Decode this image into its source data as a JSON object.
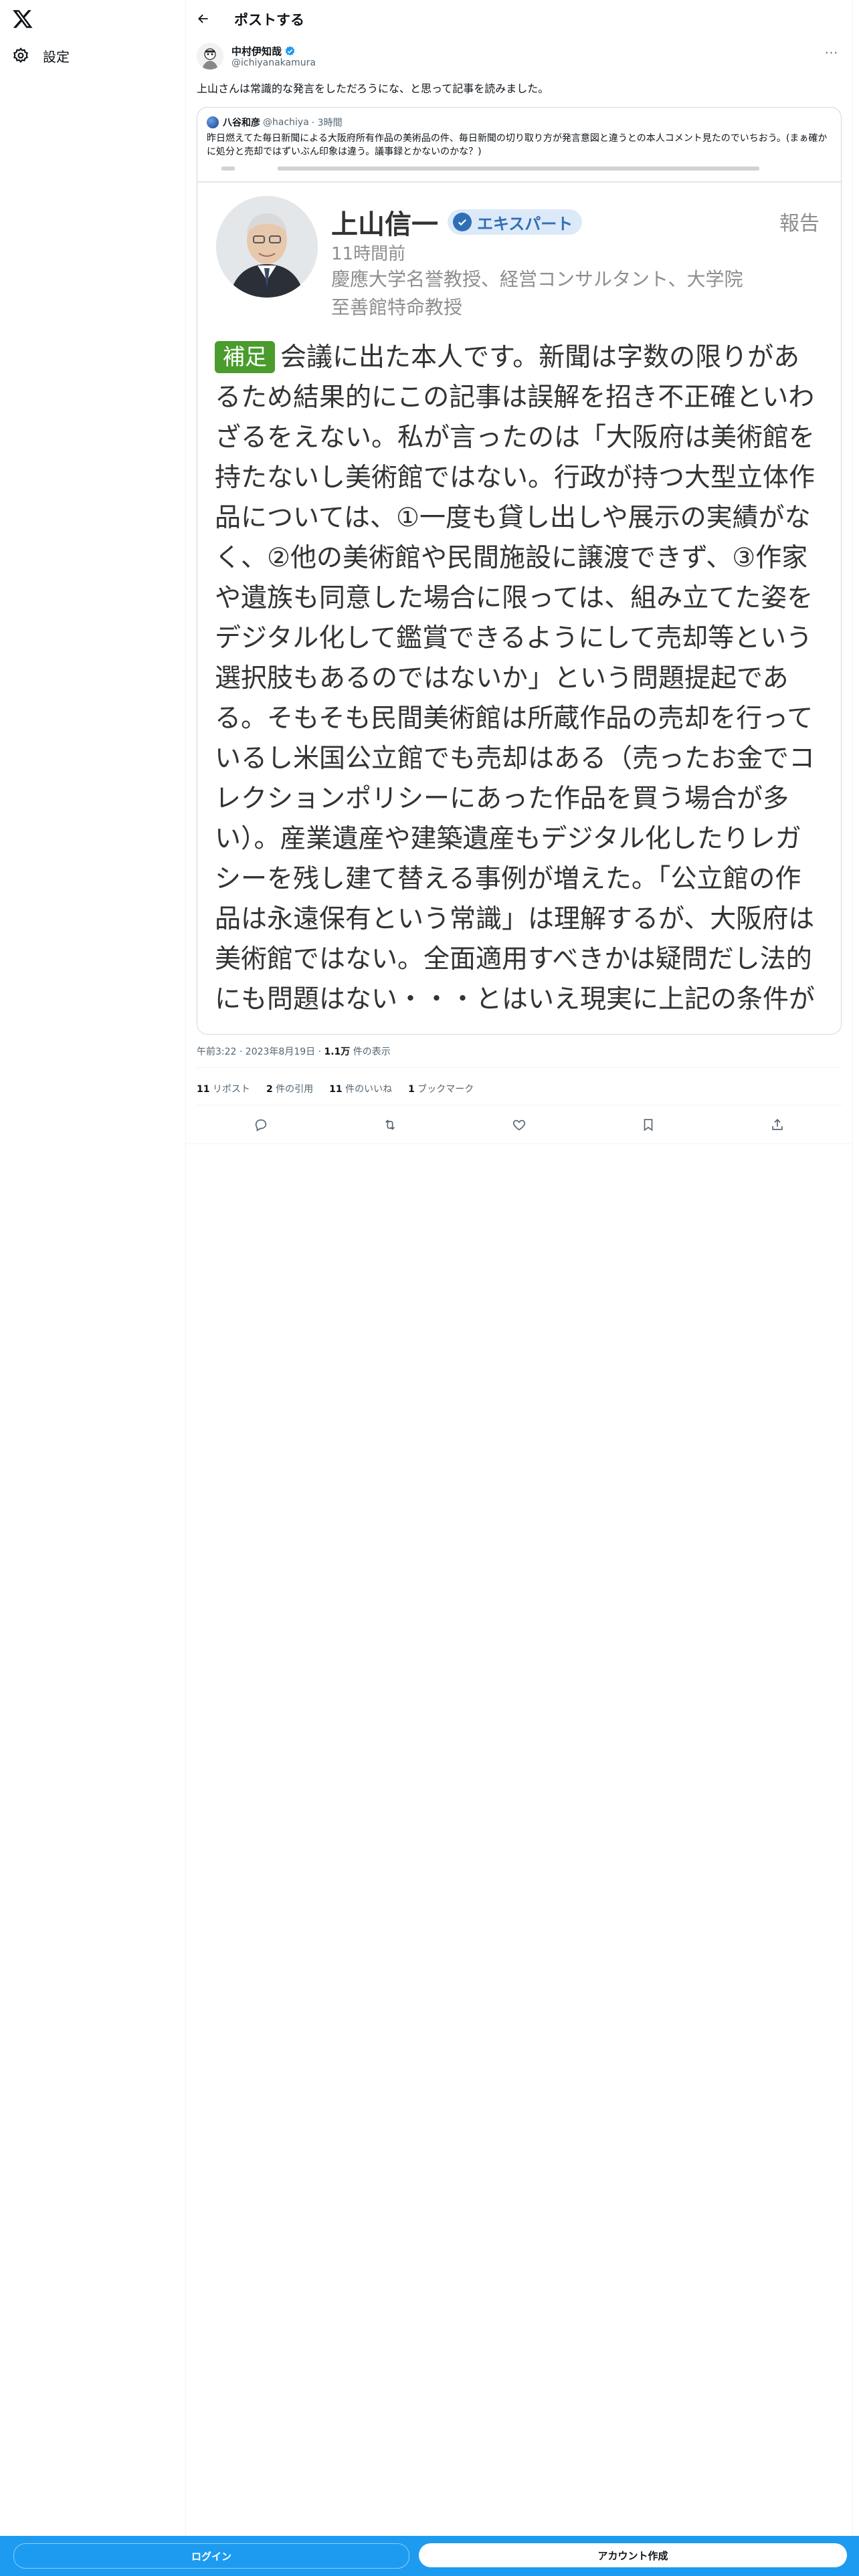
{
  "nav": {
    "settings_label": "設定"
  },
  "header": {
    "title": "ポストする"
  },
  "post": {
    "author_name": "中村伊知哉",
    "author_handle": "@ichiyanakamura",
    "text": "上山さんは常識的な発言をしただろうにな、と思って記事を読みました。",
    "timestamp": "午前3:22 · 2023年8月19日 · ",
    "views_count": "1.1万",
    "views_label": " 件の表示"
  },
  "quote": {
    "author_name": "八谷和彦",
    "author_handle": "@hachiya",
    "time": "· 3時間",
    "text": "昨日燃えてた毎日新聞による大阪府所有作品の美術品の件、毎日新聞の切り取り方が発言意図と違うとの本人コメント見たのでいちおう。(まぁ確かに処分と売却ではずいぶん印象は違う。議事録とかないのかな？)"
  },
  "embed": {
    "name": "上山信一",
    "badge": "エキスパート",
    "report": "報告",
    "time": "11時間前",
    "title_line1": "慶應大学名誉教授、経営コンサルタント、大学院",
    "title_line2": "至善館特命教授",
    "tag": "補足",
    "body": "会議に出た本人です。新聞は字数の限りがあるため結果的にこの記事は誤解を招き不正確といわざるをえない。私が言ったのは「大阪府は美術館を持たないし美術館ではない。行政が持つ大型立体作品については、①一度も貸し出しや展示の実績がなく、②他の美術館や民間施設に譲渡できず、③作家や遺族も同意した場合に限っては、組み立てた姿をデジタル化して鑑賞できるようにして売却等という選択肢もあるのではないか」という問題提起である。そもそも民間美術館は所蔵作品の売却を行っているし米国公立館でも売却はある（売ったお金でコレクションポリシーにあった作品を買う場合が多い）。産業遺産や建築遺産もデジタル化したりレガシーを残し建て替える事例が増えた。「公立館の作品は永遠保有という常識」は理解するが、大阪府は美術館ではない。全面適用すべきかは疑問だし法的にも問題はない・・・とはいえ現実に上記の条件が"
  },
  "stats": [
    {
      "count": "11",
      "label": " リポスト"
    },
    {
      "count": "2",
      "label": " 件の引用"
    },
    {
      "count": "11",
      "label": " 件のいいね"
    },
    {
      "count": "1",
      "label": " ブックマーク"
    }
  ],
  "bottom": {
    "login": "ログイン",
    "signup": "アカウント作成"
  },
  "colors": {
    "accent": "#1d9bf0",
    "tag_green": "#4a9c2d",
    "expert_blue": "#2f6fb7"
  }
}
